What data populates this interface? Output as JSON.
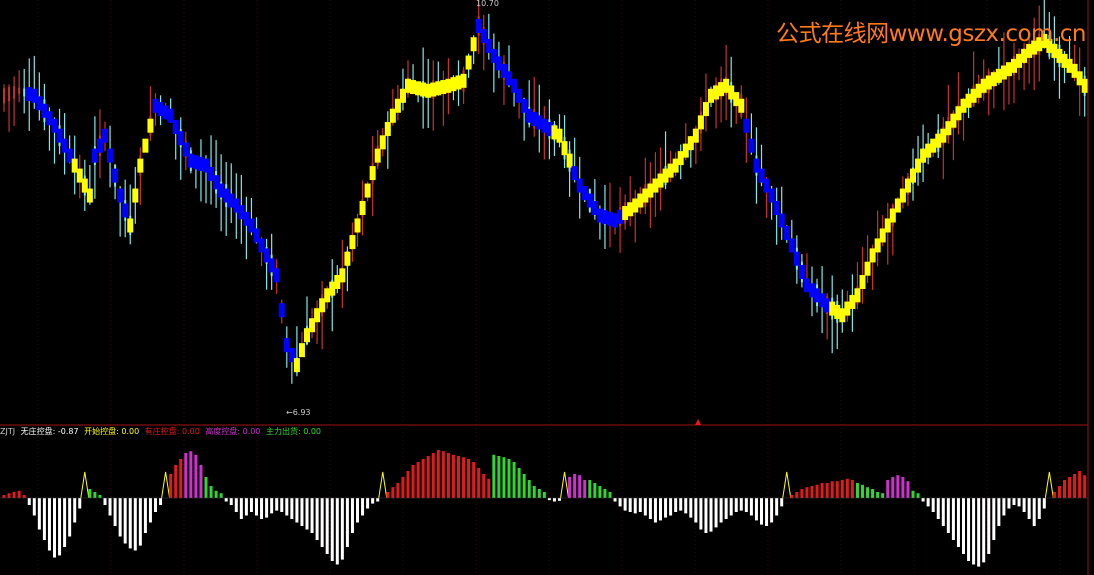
{
  "watermark": "公式在线网www.gszx.com.cn",
  "chart_data": {
    "type": "candlestick",
    "price_high_label": "10.70",
    "price_low_label": "←6.93",
    "price_range": [
      6.7,
      10.8
    ],
    "colors": {
      "up": "#c8322a",
      "down": "#7fe8e8",
      "trend_up": "#ffff00",
      "trend_down": "#0000ff",
      "white_bar": "#ffffff",
      "red_bar": "#e21a1a",
      "green_bar": "#2fd82f",
      "magenta_bar": "#d030d0",
      "yellow_tri": "#ffff00"
    },
    "price_path": [
      [
        0,
        9.9
      ],
      [
        3,
        9.95
      ],
      [
        6,
        9.9
      ],
      [
        10,
        9.6
      ],
      [
        14,
        9.2
      ],
      [
        17,
        8.9
      ],
      [
        18,
        9.3
      ],
      [
        20,
        9.5
      ],
      [
        23,
        8.9
      ],
      [
        25,
        8.6
      ],
      [
        27,
        9.2
      ],
      [
        30,
        9.8
      ],
      [
        33,
        9.7
      ],
      [
        37,
        9.25
      ],
      [
        40,
        9.2
      ],
      [
        43,
        8.95
      ],
      [
        46,
        8.8
      ],
      [
        49,
        8.6
      ],
      [
        51,
        8.4
      ],
      [
        54,
        8.1
      ],
      [
        56,
        7.4
      ],
      [
        58,
        7.2
      ],
      [
        60,
        7.5
      ],
      [
        64,
        7.9
      ],
      [
        67,
        8.1
      ],
      [
        70,
        8.6
      ],
      [
        74,
        9.3
      ],
      [
        77,
        9.7
      ],
      [
        80,
        10.0
      ],
      [
        84,
        9.95
      ],
      [
        88,
        10.0
      ],
      [
        91,
        10.05
      ],
      [
        94,
        10.6
      ],
      [
        97,
        10.3
      ],
      [
        101,
        10.0
      ],
      [
        104,
        9.7
      ],
      [
        107,
        9.6
      ],
      [
        110,
        9.5
      ],
      [
        114,
        9.0
      ],
      [
        118,
        8.7
      ],
      [
        121,
        8.65
      ],
      [
        125,
        8.8
      ],
      [
        129,
        9.0
      ],
      [
        133,
        9.2
      ],
      [
        137,
        9.5
      ],
      [
        140,
        9.9
      ],
      [
        143,
        10.0
      ],
      [
        146,
        9.8
      ],
      [
        149,
        9.2
      ],
      [
        152,
        8.9
      ],
      [
        156,
        8.4
      ],
      [
        159,
        8.0
      ],
      [
        163,
        7.8
      ],
      [
        166,
        7.7
      ],
      [
        169,
        7.9
      ],
      [
        172,
        8.3
      ],
      [
        175,
        8.6
      ],
      [
        178,
        8.9
      ],
      [
        182,
        9.3
      ],
      [
        186,
        9.5
      ],
      [
        190,
        9.8
      ],
      [
        194,
        10.0
      ],
      [
        197,
        10.1
      ],
      [
        200,
        10.2
      ],
      [
        203,
        10.35
      ],
      [
        206,
        10.45
      ],
      [
        209,
        10.3
      ],
      [
        212,
        10.15
      ],
      [
        214,
        10.0
      ]
    ],
    "trend_series": [
      {
        "color": "trend_down",
        "from": 5,
        "to": 13
      },
      {
        "color": "trend_up",
        "from": 14,
        "to": 17
      },
      {
        "color": "trend_down",
        "from": 18,
        "to": 24
      },
      {
        "color": "trend_up",
        "from": 25,
        "to": 29
      },
      {
        "color": "trend_down",
        "from": 30,
        "to": 57
      },
      {
        "color": "trend_up",
        "from": 58,
        "to": 93
      },
      {
        "color": "trend_down",
        "from": 94,
        "to": 108
      },
      {
        "color": "trend_up",
        "from": 109,
        "to": 112
      },
      {
        "color": "trend_down",
        "from": 113,
        "to": 122
      },
      {
        "color": "trend_up",
        "from": 123,
        "to": 146
      },
      {
        "color": "trend_down",
        "from": 147,
        "to": 163
      },
      {
        "color": "trend_up",
        "from": 164,
        "to": 174
      },
      {
        "color": "trend_up",
        "from": 175,
        "to": 214
      }
    ],
    "indicator": {
      "name": "ZJTJ",
      "legend": [
        {
          "label": "无庄控盘: -0.87",
          "color": "#ffffff"
        },
        {
          "label": "开始控盘: 0.00",
          "color": "#ffff00"
        },
        {
          "label": "有庄控盘: 0.00",
          "color": "#e21a1a"
        },
        {
          "label": "高度控盘: 0.00",
          "color": "#d030d0"
        },
        {
          "label": "主力出货: 0.00",
          "color": "#2fd82f"
        }
      ],
      "range": [
        -1.0,
        0.9
      ],
      "segments": [
        {
          "type": "red_bar",
          "from": 0,
          "to": 4,
          "values": [
            0.05,
            0.08,
            0.1,
            0.12,
            0.05
          ]
        },
        {
          "type": "white_bar",
          "from": 5,
          "to": 15,
          "values": [
            -0.1,
            -0.25,
            -0.45,
            -0.6,
            -0.75,
            -0.85,
            -0.82,
            -0.7,
            -0.55,
            -0.35,
            -0.15
          ]
        },
        {
          "type": "yellow_tri",
          "at": 16
        },
        {
          "type": "green_bar",
          "from": 17,
          "to": 19,
          "values": [
            0.15,
            0.1,
            0.05
          ]
        },
        {
          "type": "white_bar",
          "from": 20,
          "to": 31,
          "values": [
            -0.1,
            -0.25,
            -0.4,
            -0.55,
            -0.65,
            -0.72,
            -0.75,
            -0.68,
            -0.5,
            -0.35,
            -0.2,
            -0.1
          ]
        },
        {
          "type": "yellow_tri",
          "at": 32
        },
        {
          "type": "red_bar",
          "from": 33,
          "to": 35,
          "values": [
            0.4,
            0.55,
            0.65
          ]
        },
        {
          "type": "magenta_bar",
          "from": 36,
          "to": 39,
          "values": [
            0.75,
            0.78,
            0.72,
            0.55
          ]
        },
        {
          "type": "green_bar",
          "from": 40,
          "to": 43,
          "values": [
            0.35,
            0.2,
            0.12,
            0.08
          ]
        },
        {
          "type": "white_bar",
          "from": 44,
          "to": 74,
          "values": [
            -0.05,
            -0.1,
            -0.2,
            -0.3,
            -0.25,
            -0.2,
            -0.25,
            -0.3,
            -0.28,
            -0.22,
            -0.18,
            -0.2,
            -0.25,
            -0.3,
            -0.35,
            -0.4,
            -0.45,
            -0.5,
            -0.6,
            -0.7,
            -0.8,
            -0.9,
            -0.95,
            -0.88,
            -0.7,
            -0.5,
            -0.35,
            -0.25,
            -0.15,
            -0.08,
            -0.05
          ]
        },
        {
          "type": "yellow_tri",
          "at": 75
        },
        {
          "type": "red_bar",
          "from": 76,
          "to": 96,
          "values": [
            0.1,
            0.18,
            0.25,
            0.35,
            0.45,
            0.55,
            0.6,
            0.65,
            0.7,
            0.75,
            0.8,
            0.78,
            0.75,
            0.72,
            0.7,
            0.68,
            0.65,
            0.6,
            0.5,
            0.4,
            0.32
          ]
        },
        {
          "type": "green_bar",
          "from": 97,
          "to": 107,
          "values": [
            0.72,
            0.7,
            0.68,
            0.65,
            0.6,
            0.5,
            0.4,
            0.3,
            0.2,
            0.15,
            0.1
          ]
        },
        {
          "type": "white_bar",
          "from": 108,
          "to": 110,
          "values": [
            -0.03,
            -0.05,
            -0.04
          ]
        },
        {
          "type": "yellow_tri",
          "at": 111
        },
        {
          "type": "magenta_bar",
          "from": 112,
          "to": 115,
          "values": [
            0.35,
            0.4,
            0.38,
            0.3
          ]
        },
        {
          "type": "green_bar",
          "from": 116,
          "to": 120,
          "values": [
            0.3,
            0.25,
            0.2,
            0.15,
            0.1
          ]
        },
        {
          "type": "white_bar",
          "from": 121,
          "to": 154,
          "values": [
            -0.05,
            -0.12,
            -0.18,
            -0.2,
            -0.22,
            -0.2,
            -0.25,
            -0.3,
            -0.35,
            -0.32,
            -0.28,
            -0.25,
            -0.2,
            -0.18,
            -0.22,
            -0.28,
            -0.35,
            -0.45,
            -0.5,
            -0.48,
            -0.42,
            -0.35,
            -0.3,
            -0.25,
            -0.2,
            -0.18,
            -0.2,
            -0.25,
            -0.32,
            -0.38,
            -0.4,
            -0.35,
            -0.25,
            -0.12
          ]
        },
        {
          "type": "yellow_tri",
          "at": 155
        },
        {
          "type": "red_bar",
          "from": 156,
          "to": 168,
          "values": [
            0.05,
            0.1,
            0.15,
            0.18,
            0.2,
            0.22,
            0.25,
            0.25,
            0.28,
            0.28,
            0.3,
            0.32,
            0.3
          ]
        },
        {
          "type": "green_bar",
          "from": 169,
          "to": 174,
          "values": [
            0.25,
            0.22,
            0.18,
            0.15,
            0.1,
            0.08
          ]
        },
        {
          "type": "magenta_bar",
          "from": 175,
          "to": 179,
          "values": [
            0.3,
            0.35,
            0.38,
            0.35,
            0.28
          ]
        },
        {
          "type": "green_bar",
          "from": 180,
          "to": 181,
          "values": [
            0.12,
            0.08
          ]
        },
        {
          "type": "white_bar",
          "from": 182,
          "to": 206,
          "values": [
            -0.05,
            -0.12,
            -0.2,
            -0.3,
            -0.4,
            -0.5,
            -0.6,
            -0.7,
            -0.8,
            -0.9,
            -0.95,
            -0.98,
            -0.92,
            -0.8,
            -0.6,
            -0.4,
            -0.25,
            -0.15,
            -0.1,
            -0.12,
            -0.2,
            -0.3,
            -0.4,
            -0.3,
            -0.15
          ]
        },
        {
          "type": "yellow_tri",
          "at": 207
        },
        {
          "type": "red_bar",
          "from": 208,
          "to": 214,
          "values": [
            0.1,
            0.2,
            0.3,
            0.35,
            0.4,
            0.45,
            0.38
          ]
        }
      ]
    }
  }
}
